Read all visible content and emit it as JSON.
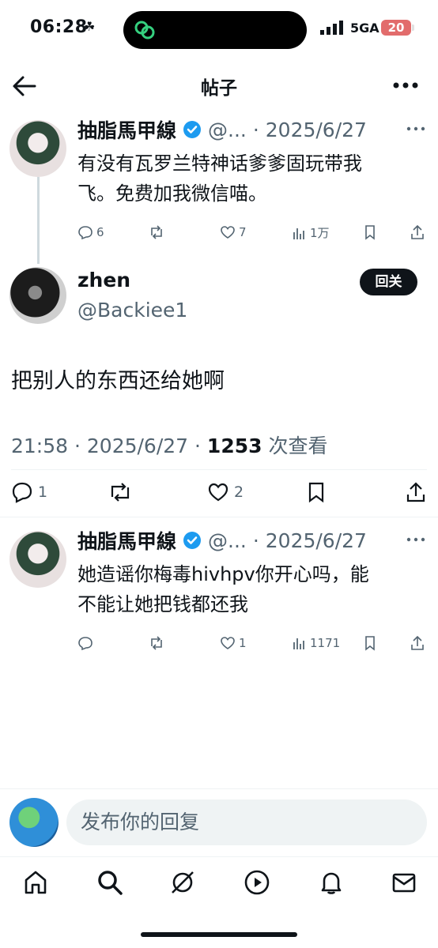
{
  "status_bar": {
    "time": "06:28",
    "network": "5GA",
    "battery": "20"
  },
  "header": {
    "title": "帖子"
  },
  "tweet1": {
    "name": "抽脂馬甲線",
    "handle": "@...",
    "date": "· 2025/6/27",
    "text_line1": "有没有瓦罗兰特神话爹爹固玩带我",
    "text_line2": "飞。免费加我微信喵。",
    "replies": "6",
    "likes": "7",
    "views": "1万"
  },
  "main_tweet": {
    "name": "zhen",
    "handle": "@Backiee1",
    "follow_label": "回关",
    "text": "把别人的东西还给她啊",
    "time": "21:58 · 2025/6/27 · ",
    "views_count": "1253",
    "views_label": " 次查看",
    "replies": "1",
    "likes": "2"
  },
  "tweet3": {
    "name": "抽脂馬甲線",
    "handle": "@...",
    "date": "· 2025/6/27",
    "text_line1": "她造谣你梅毒hivhpv你开心吗，能",
    "text_line2": "不能让她把钱都还我",
    "likes": "1",
    "views": "1171"
  },
  "reply_bar": {
    "placeholder": "发布你的回复"
  },
  "colors": {
    "text": "#0f1419",
    "secondary": "#536471",
    "verified": "#1d9bf0",
    "battery": "#e26c6c"
  }
}
